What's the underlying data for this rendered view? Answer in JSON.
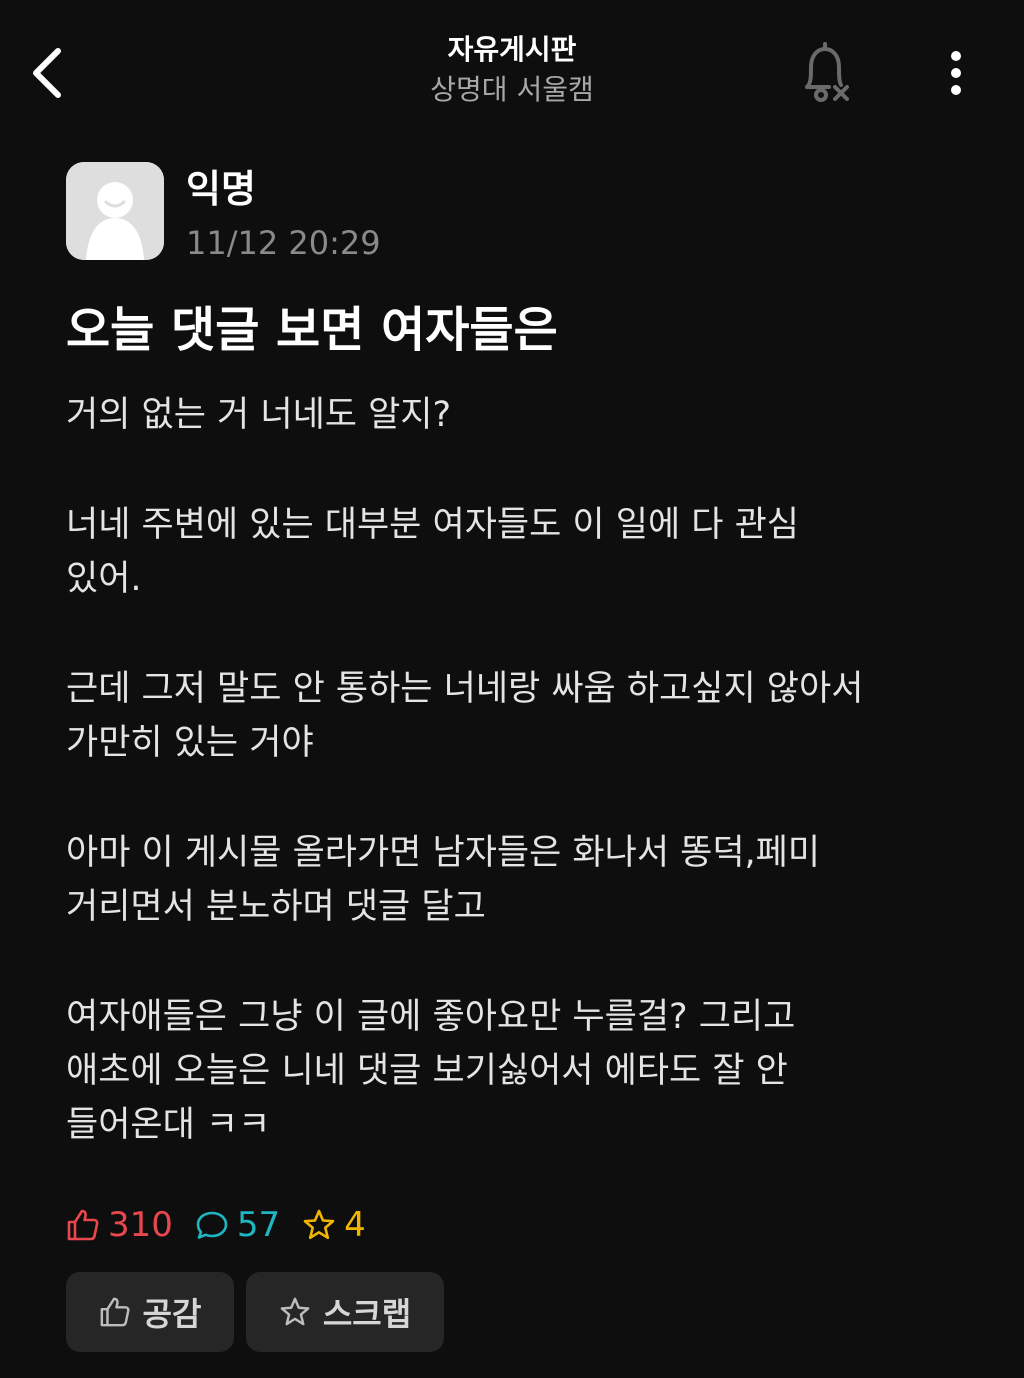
{
  "header": {
    "board_title": "자유게시판",
    "board_subtitle": "상명대 서울캠",
    "icons": {
      "back": "chevron-left-icon",
      "notification": "bell-off-icon",
      "more": "more-vertical-icon"
    }
  },
  "post": {
    "author": "익명",
    "time": "11/12 20:29",
    "title": "오늘 댓글 보면 여자들은",
    "paragraphs": [
      "거의 없는 거 너네도 알지?",
      "너네 주변에 있는 대부분 여자들도 이 일에 다 관심\n있어.",
      "근데 그저 말도 안 통하는 너네랑 싸움 하고싶지 않아서\n가만히 있는 거야",
      "아마 이 게시물 올라가면 남자들은 화나서 똥덕,페미\n거리면서 분노하며 댓글 달고",
      "여자애들은 그냥 이 글에 좋아요만 누를걸? 그리고\n애초에 오늘은 니네 댓글 보기싫어서 에타도 잘 안\n들어온대 ㅋㅋ"
    ]
  },
  "stats": {
    "likes": "310",
    "comments": "57",
    "scraps": "4"
  },
  "actions": {
    "like_label": "공감",
    "scrap_label": "스크랩"
  },
  "colors": {
    "background": "#0e0e0e",
    "like": "#e8484d",
    "comment": "#1fb5c2",
    "scrap": "#f2b600",
    "button_bg": "#262626"
  }
}
